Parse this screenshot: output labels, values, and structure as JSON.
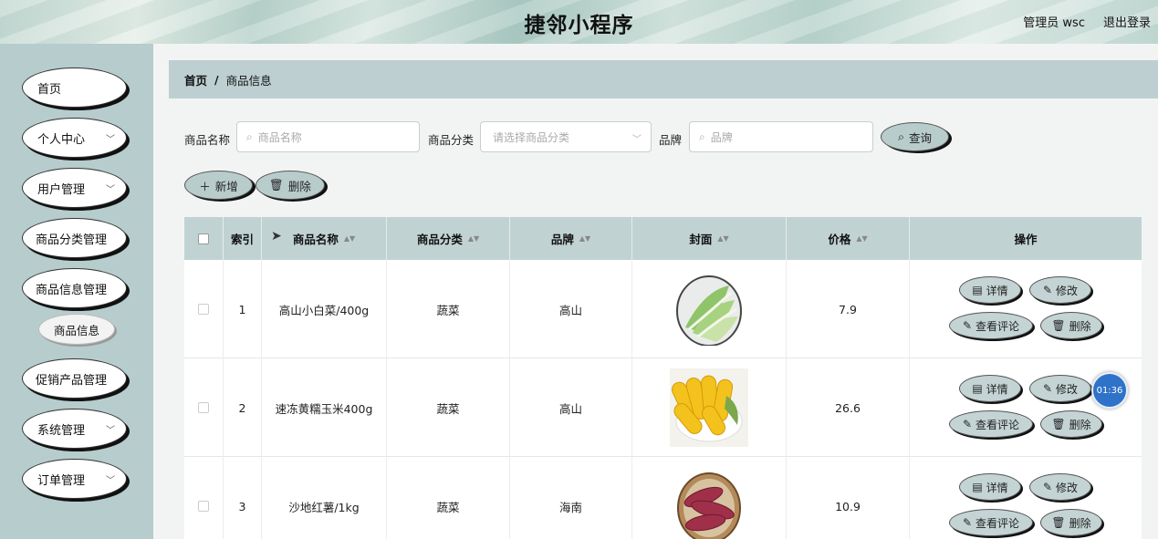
{
  "header": {
    "title": "捷邻小程序",
    "user": "管理员 wsc",
    "logout": "退出登录"
  },
  "sidebar": {
    "items": [
      {
        "label": "首页"
      },
      {
        "label": "个人中心"
      },
      {
        "label": "用户管理"
      },
      {
        "label": "商品分类管理"
      },
      {
        "label": "商品信息管理"
      },
      {
        "label": "促销产品管理"
      },
      {
        "label": "系统管理"
      },
      {
        "label": "订单管理"
      }
    ],
    "sub_item": "商品信息"
  },
  "breadcrumb": {
    "home": "首页",
    "sep": "/",
    "current": "商品信息"
  },
  "filters": {
    "name_label": "商品名称",
    "name_placeholder": "商品名称",
    "category_label": "商品分类",
    "category_placeholder": "请选择商品分类",
    "brand_label": "品牌",
    "brand_placeholder": "品牌",
    "search_button": "查询"
  },
  "toolbar": {
    "add": "新增",
    "delete": "删除"
  },
  "table": {
    "headers": [
      "索引",
      "商品名称",
      "商品分类",
      "品牌",
      "封面",
      "价格",
      "操作"
    ],
    "rows": [
      {
        "index": "1",
        "name": "高山小白菜/400g",
        "category": "蔬菜",
        "brand": "高山",
        "price": "7.9"
      },
      {
        "index": "2",
        "name": "速冻黄糯玉米400g",
        "category": "蔬菜",
        "brand": "高山",
        "price": "26.6"
      },
      {
        "index": "3",
        "name": "沙地红薯/1kg",
        "category": "蔬菜",
        "brand": "海南",
        "price": "10.9"
      }
    ],
    "actions": {
      "detail": "详情",
      "edit": "修改",
      "comments": "查看评论",
      "delete": "删除"
    }
  },
  "timer": "01:36"
}
